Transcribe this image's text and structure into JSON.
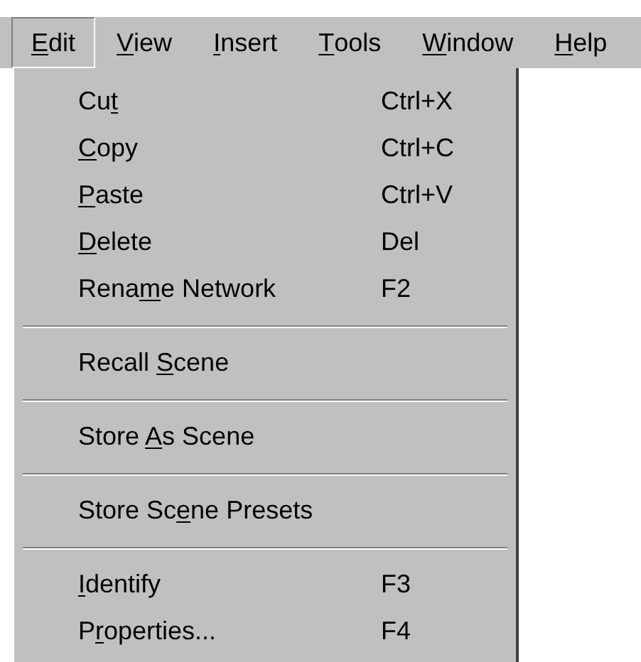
{
  "menu_bar": [
    {
      "label": {
        "key": "E",
        "post": "dit"
      },
      "selected": true
    },
    {
      "label": {
        "key": "V",
        "post": "iew"
      },
      "selected": false
    },
    {
      "label": {
        "key": "I",
        "post": "nsert"
      },
      "selected": false
    },
    {
      "label": {
        "key": "T",
        "post": "ools"
      },
      "selected": false
    },
    {
      "label": {
        "key": "W",
        "post": "indow"
      },
      "selected": false
    },
    {
      "label": {
        "key": "H",
        "post": "elp"
      },
      "selected": false
    }
  ],
  "menu": [
    {
      "kind": "item",
      "label": {
        "pre": "Cu",
        "key": "t"
      },
      "shortcut": "Ctrl+X"
    },
    {
      "kind": "item",
      "label": {
        "key": "C",
        "post": "opy"
      },
      "shortcut": "Ctrl+C"
    },
    {
      "kind": "item",
      "label": {
        "key": "P",
        "post": "aste"
      },
      "shortcut": "Ctrl+V"
    },
    {
      "kind": "item",
      "label": {
        "key": "D",
        "post": "elete"
      },
      "shortcut": "Del"
    },
    {
      "kind": "item",
      "label": {
        "pre": "Rena",
        "key": "m",
        "post": "e Network"
      },
      "shortcut": "F2"
    },
    {
      "kind": "separator"
    },
    {
      "kind": "item",
      "label": {
        "pre": "Recall ",
        "key": "S",
        "post": "cene"
      }
    },
    {
      "kind": "separator"
    },
    {
      "kind": "item",
      "label": {
        "pre": "Store ",
        "key": "A",
        "post": "s Scene"
      }
    },
    {
      "kind": "separator"
    },
    {
      "kind": "item",
      "label": {
        "pre": "Store Sc",
        "key": "e",
        "post": "ne Presets"
      }
    },
    {
      "kind": "separator"
    },
    {
      "kind": "item",
      "label": {
        "key": "I",
        "post": "dentify"
      },
      "shortcut": "F3"
    },
    {
      "kind": "item",
      "label": {
        "pre": "P",
        "key": "r",
        "post": "operties..."
      },
      "shortcut": "F4"
    }
  ]
}
